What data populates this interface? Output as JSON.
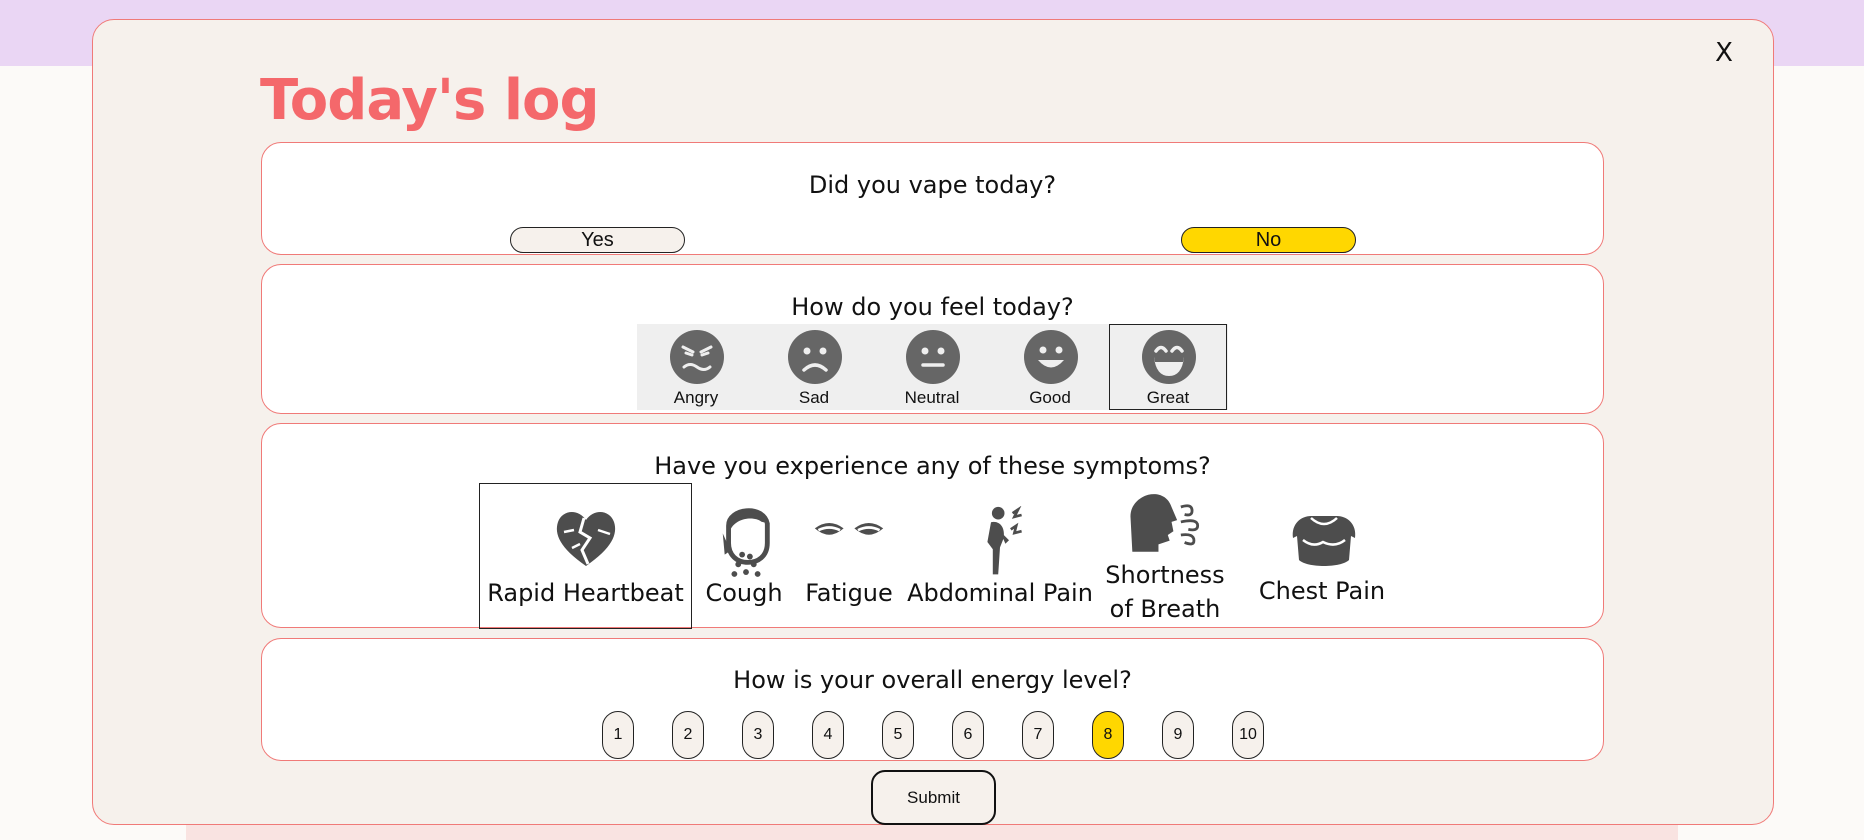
{
  "modal": {
    "title": "Today's log",
    "close_label": "X",
    "submit_label": "Submit"
  },
  "vape": {
    "question": "Did you vape today?",
    "options": [
      "Yes",
      "No"
    ],
    "selected": "No"
  },
  "mood": {
    "question": "How do you feel today?",
    "options": [
      {
        "label": "Angry",
        "icon": "angry-face-icon"
      },
      {
        "label": "Sad",
        "icon": "sad-face-icon"
      },
      {
        "label": "Neutral",
        "icon": "neutral-face-icon"
      },
      {
        "label": "Good",
        "icon": "smile-face-icon"
      },
      {
        "label": "Great",
        "icon": "grin-face-icon"
      }
    ],
    "selected": "Great"
  },
  "symptoms": {
    "question": "Have you experience any of these symptoms?",
    "options": [
      {
        "label": "Rapid Heartbeat",
        "icon": "broken-heart-icon"
      },
      {
        "label": "Cough",
        "icon": "cough-icon"
      },
      {
        "label": "Fatigue",
        "icon": "tired-eyes-icon"
      },
      {
        "label": "Abdominal Pain",
        "icon": "abdominal-pain-icon"
      },
      {
        "label": "Shortness of Breath",
        "label_line1": "Shortness",
        "label_line2": "of Breath",
        "icon": "breath-icon"
      },
      {
        "label": "Chest Pain",
        "icon": "chest-icon"
      }
    ],
    "selected": [
      "Rapid Heartbeat"
    ]
  },
  "energy": {
    "question": "How is your overall energy level?",
    "levels": [
      "1",
      "2",
      "3",
      "4",
      "5",
      "6",
      "7",
      "8",
      "9",
      "10"
    ],
    "selected": "8"
  },
  "colors": {
    "accent_title": "#f4686b",
    "selected_yellow": "#ffd700",
    "card_border": "#f07a78",
    "modal_bg": "#f6f1ec",
    "top_band": "#ead6f4"
  }
}
